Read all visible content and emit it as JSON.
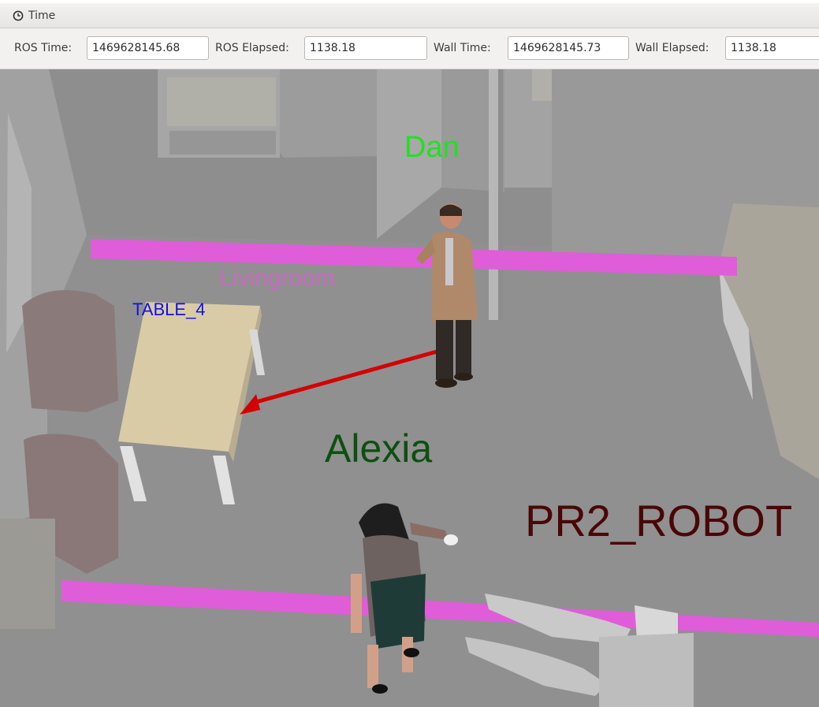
{
  "panel": {
    "title": "Time",
    "title_icon": "clock-icon"
  },
  "fields": {
    "ros_time_label": "ROS Time:",
    "ros_time_value": "1469628145.68",
    "ros_elapsed_label": "ROS Elapsed:",
    "ros_elapsed_value": "1138.18",
    "wall_time_label": "Wall Time:",
    "wall_time_value": "1469628145.73",
    "wall_elapsed_label": "Wall Elapsed:",
    "wall_elapsed_value": "1138.18"
  },
  "scene": {
    "labels": {
      "dan": "Dan",
      "livingroom": "Livingroom",
      "table": "TABLE_4",
      "alexia": "Alexia",
      "robot": "PR2_ROBOT"
    },
    "colors": {
      "dan": "#22e022",
      "livingroom": "#c76cc0",
      "table": "#1010e8",
      "alexia": "#0d5010",
      "robot": "#4a0606",
      "arrow": "#d40000",
      "room_boundary": "#e060d8"
    }
  }
}
